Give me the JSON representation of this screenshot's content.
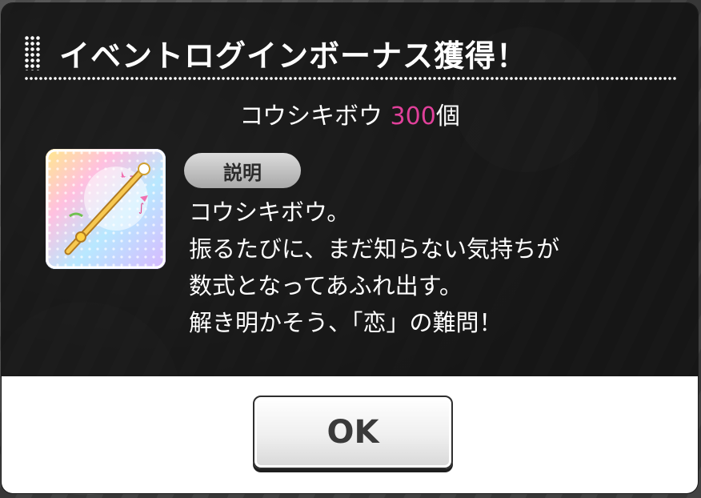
{
  "dialog": {
    "title": "イベントログインボーナス獲得！",
    "reward": {
      "item_name": "コウシキボウ",
      "quantity": "300",
      "unit": "個"
    },
    "item_icon": "magic-wand-icon",
    "description": {
      "badge_label": "説明",
      "lines": [
        "コウシキボウ。",
        "振るたびに、まだ知らない気持ちが",
        "数式となってあふれ出す。",
        "解き明かそう、「恋」の難問！"
      ]
    },
    "ok_label": "OK"
  },
  "colors": {
    "quantity_accent": "#e0409a",
    "dialog_dark": "#121212",
    "dialog_light": "#ffffff"
  }
}
